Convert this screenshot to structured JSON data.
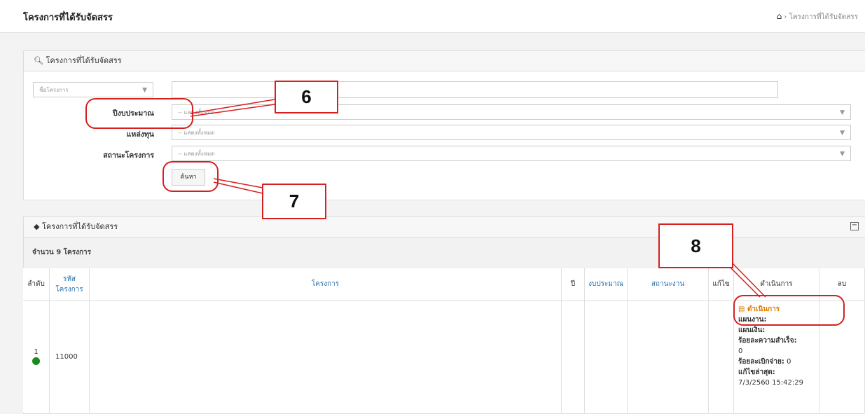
{
  "header": {
    "title": "โครงการที่ได้รับจัดสรร",
    "breadcrumb_current": "โครงการที่ได้รับจัดสรร"
  },
  "search_panel": {
    "title": "โครงการที่ได้รับจัดสรร",
    "field_select": "ชื่อโครงการ",
    "search_text_value": "",
    "budget_year_label": "ปีงบประมาณ",
    "budget_year_value": "-- แสดงทั้งหมด",
    "fund_source_label": "แหล่งทุน",
    "fund_source_value": "-- แสดงทั้งหมด",
    "status_label": "สถานะโครงการ",
    "status_value": "-- แสดงทั้งหมด",
    "search_button": "ค้นหา"
  },
  "results_panel": {
    "title": "โครงการที่ได้รับจัดสรร",
    "count_text": "จำนวน 9 โครงการ",
    "columns": [
      "ลำดับ",
      "รหัสโครงการ",
      "โครงการ",
      "ปี",
      "งบประมาณ",
      "สถานะงาน",
      "แก้ไข",
      "ดำเนินการ",
      "ลบ"
    ],
    "rows": [
      {
        "index": "1",
        "code": "11000",
        "action_link": "ดำเนินการ",
        "plan_label": "แผนงาน:",
        "finance_label": "แผนเงิน:",
        "success_label": "ร้อยละความสำเร็จ:",
        "success_value": "0",
        "disburse_label": "ร้อยละเบิกจ่าย:",
        "disburse_value": "0",
        "edited_label": "แก้ไขล่าสุด:",
        "edited_value": "7/3/2560 15:42:29",
        "status_color": "#1a8a1a"
      }
    ]
  },
  "annotations": [
    "6",
    "7",
    "8"
  ],
  "colors": {
    "accent_red": "#d62020",
    "link_blue": "#2a6fb0",
    "action_orange": "#e07b00"
  }
}
